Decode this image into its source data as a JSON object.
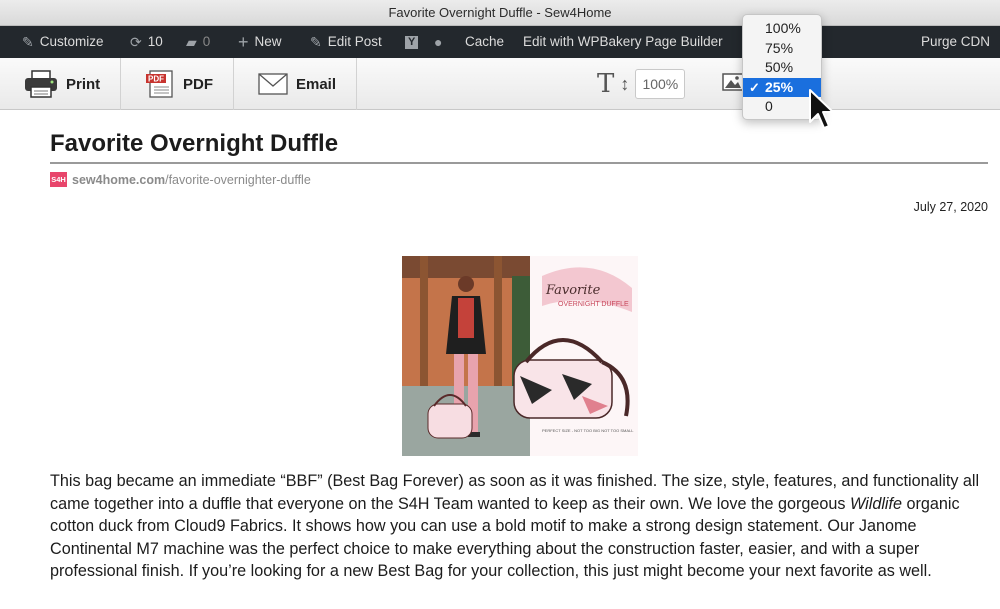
{
  "window": {
    "title": "Favorite Overnight Duffle - Sew4Home"
  },
  "admin_bar": {
    "customize": "Customize",
    "updates_count": "10",
    "comments_count": "0",
    "new": "New",
    "edit_post": "Edit Post",
    "cache": "Cache",
    "wpbakery": "Edit with WPBakery Page Builder",
    "purge_cdn": "Purge CDN"
  },
  "toolbar": {
    "print": "Print",
    "pdf": "PDF",
    "email": "Email",
    "text_size_value": "100%"
  },
  "image_size_dropdown": {
    "options": [
      "100%",
      "75%",
      "50%",
      "25%",
      "0"
    ],
    "selected": "25%"
  },
  "article": {
    "title": "Favorite Overnight Duffle",
    "source_domain": "sew4home.com",
    "source_path": "/favorite-overnighter-duffle",
    "logo_text": "S4H",
    "date": "July 27, 2020",
    "image_caption_title": "Favorite",
    "image_caption_subtitle": "OVERNIGHT DUFFLE",
    "image_small_text": "PERFECT SIZE - NOT TOO BIG NOT TOO SMALL",
    "body_part1": "This bag became an immediate “BBF” (Best Bag Forever) as soon as it was finished. The size, style, features, and functionality all came together into a duffle that everyone on the S4H Team wanted to keep as their own. We love the gorgeous ",
    "body_italic": "Wildlife",
    "body_part2": " organic cotton duck from Cloud9 Fabrics. It shows how you can use a bold motif to make a strong design statement. Our Janome Continental M7 machine was the perfect choice to make everything about the construction faster, easier, and with a super professional finish. If you’re looking for a new Best Bag for your collection, this just might become your next favorite as well."
  },
  "colors": {
    "accent": "#1a6fde",
    "admin_bar": "#23282d",
    "brand": "#e8456b"
  }
}
